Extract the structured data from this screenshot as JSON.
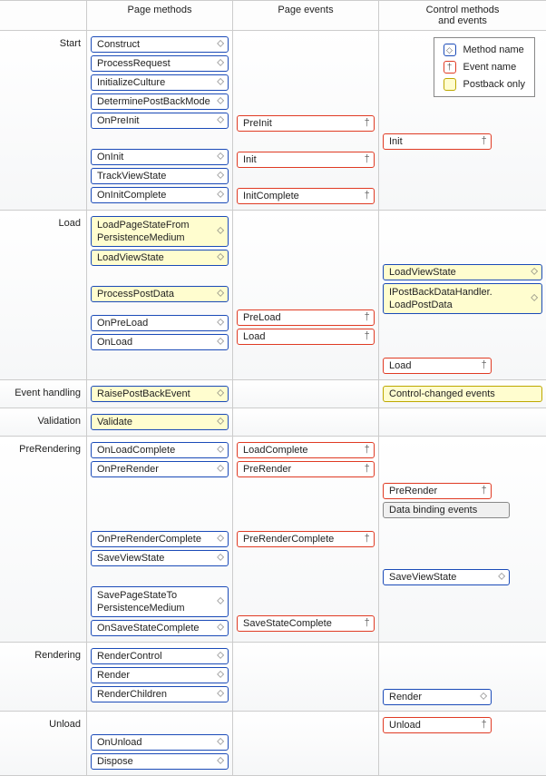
{
  "columns": {
    "phase": "",
    "pm": "Page methods",
    "pe": "Page events",
    "ce": "Control methods\nand events"
  },
  "legend": {
    "method": "Method name",
    "event": "Event name",
    "postback": "Postback only"
  },
  "phases": {
    "start": "Start",
    "load": "Load",
    "eh": "Event handling",
    "val": "Validation",
    "prer": "PreRendering",
    "rend": "Rendering",
    "unload": "Unload"
  },
  "items": {
    "construct": "Construct",
    "processrequest": "ProcessRequest",
    "initculture": "InitializeCulture",
    "detpb": "DeterminePostBackMode",
    "onpreinit": "OnPreInit",
    "oninit": "OnInit",
    "trackvs": "TrackViewState",
    "oninitc": "OnInitComplete",
    "preinit_e": "PreInit",
    "init_e": "Init",
    "initc_e": "InitComplete",
    "c_init_e": "Init",
    "lpsfpm": "LoadPageStateFrom\nPersistenceMedium",
    "loadvs": "LoadViewState",
    "ppd": "ProcessPostData",
    "onpreload": "OnPreLoad",
    "onload": "OnLoad",
    "preload_e": "PreLoad",
    "load_e": "Load",
    "c_loadvs": "LoadViewState",
    "c_ipbdh": "IPostBackDataHandler.\nLoadPostData",
    "c_load_e": "Load",
    "rpb": "RaisePostBackEvent",
    "c_cce": "Control-changed events",
    "validate": "Validate",
    "onloadc": "OnLoadComplete",
    "onprer": "OnPreRender",
    "onprerc": "OnPreRenderComplete",
    "savevs": "SaveViewState",
    "spstpm": "SavePageStateTo\nPersistenceMedium",
    "onssc": "OnSaveStateComplete",
    "loadc_e": "LoadComplete",
    "prer_e": "PreRender",
    "prerc_e": "PreRenderComplete",
    "ssc_e": "SaveStateComplete",
    "c_prer_e": "PreRender",
    "c_dbe": "Data binding events",
    "c_savevs": "SaveViewState",
    "renderctl": "RenderControl",
    "render": "Render",
    "renderch": "RenderChildren",
    "c_render": "Render",
    "onunload": "OnUnload",
    "dispose": "Dispose",
    "c_unload_e": "Unload"
  }
}
